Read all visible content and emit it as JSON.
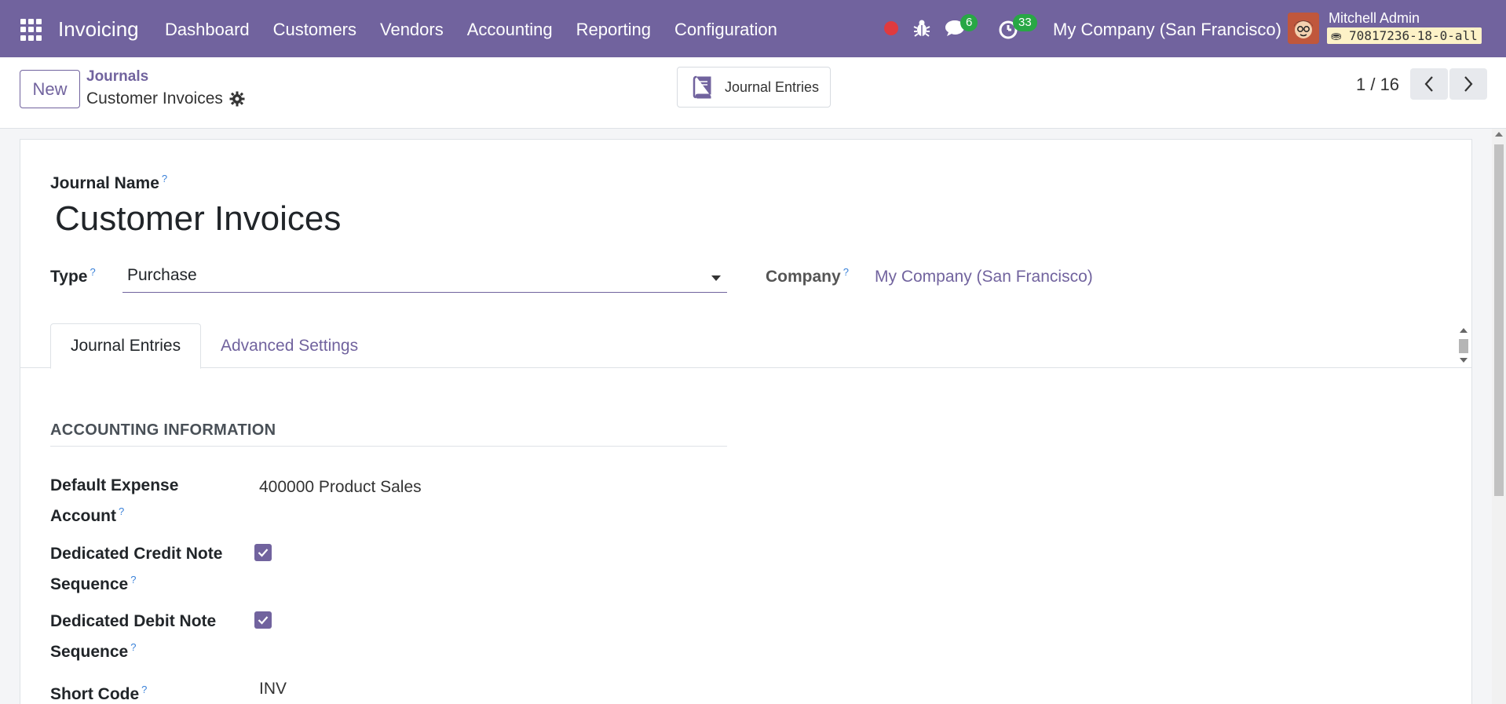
{
  "navbar": {
    "app_name": "Invoicing",
    "menu": [
      "Dashboard",
      "Customers",
      "Vendors",
      "Accounting",
      "Reporting",
      "Configuration"
    ],
    "messages_count": "6",
    "activities_count": "33",
    "company": "My Company (San Francisco)",
    "user_name": "Mitchell Admin",
    "database": "70817236-18-0-all",
    "accent_color": "#71639e"
  },
  "control_panel": {
    "new_label": "New",
    "breadcrumb_parent": "Journals",
    "breadcrumb_current": "Customer Invoices",
    "smart_button_label": "Journal Entries",
    "pager": "1 / 16"
  },
  "form": {
    "journal_name_label": "Journal Name",
    "journal_name": "Customer Invoices",
    "type_label": "Type",
    "type_value": "Purchase",
    "company_label": "Company",
    "company_value": "My Company (San Francisco)",
    "help_mark": "?",
    "tabs": [
      "Journal Entries",
      "Advanced Settings"
    ],
    "section_title": "ACCOUNTING INFORMATION",
    "fields": {
      "default_expense_account_label": "Default Expense Account",
      "default_expense_account_value": "400000 Product Sales",
      "dedicated_credit_note_label": "Dedicated Credit Note Sequence",
      "dedicated_credit_note_checked": true,
      "dedicated_debit_note_label": "Dedicated Debit Note Sequence",
      "dedicated_debit_note_checked": true,
      "short_code_label": "Short Code",
      "short_code_value": "INV"
    }
  }
}
